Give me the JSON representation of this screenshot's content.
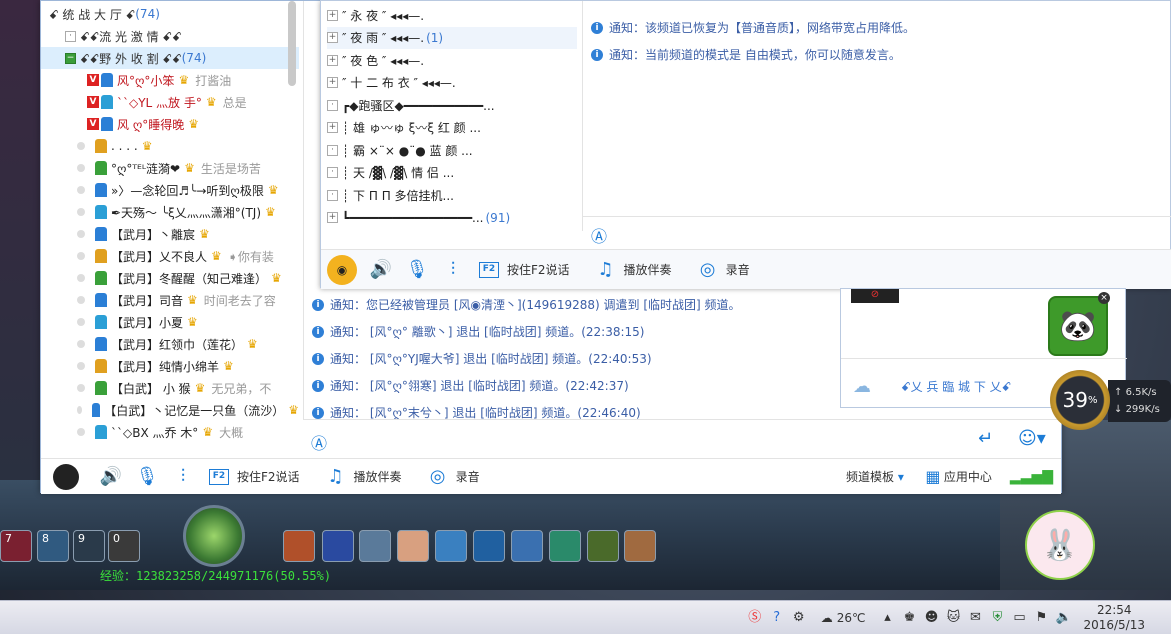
{
  "colors": {
    "accent": "#1d7cd6",
    "notice": "#3b5ea6",
    "exp_green": "#3be03b",
    "red_name": "#c0161e"
  },
  "tree": {
    "rows": [
      {
        "kind": "channel",
        "text": "ꗃ  统 战 大 厅  ꗃ",
        "count": "(74)"
      },
      {
        "kind": "sub",
        "text": "ꗃꗃ流 光 激 情 ꗃꗃ"
      },
      {
        "kind": "sub-open",
        "text": "ꗃꗃ野 外 收 割 ꗃꗃ",
        "count": "(74)"
      },
      {
        "kind": "user",
        "name": "风°ღ°小笨",
        "sig": "打酱油",
        "red": true,
        "rank": "V",
        "badge": "♛"
      },
      {
        "kind": "user",
        "name": "``◇YL    灬放 手°",
        "sig": "总是",
        "red": true,
        "rank": "V",
        "badge": "♛"
      },
      {
        "kind": "user",
        "name": "风 ღ°睡得晚",
        "sig": "",
        "red": true,
        "rank": "V",
        "badge": "♛"
      },
      {
        "kind": "user",
        "name": ". . . .",
        "sig": "",
        "red": false,
        "rank": "",
        "badge": "♛"
      },
      {
        "kind": "user",
        "name": "°ღ°ᵀᴱᴸ涟漪❤",
        "sig": "生活是场苦",
        "red": false,
        "rank": "",
        "badge": "♛"
      },
      {
        "kind": "user",
        "name": "»〉—念轮回♬╰→听到ღ极限",
        "sig": "",
        "red": false,
        "rank": "",
        "badge": "♛"
      },
      {
        "kind": "user",
        "name": "✒天殇〜 ╰ξ乂灬灬潇湘°(TJ)",
        "sig": "",
        "red": false,
        "rank": "",
        "badge": "♛"
      },
      {
        "kind": "user",
        "name": "【武月】丶離宸",
        "sig": "",
        "red": false,
        "rank": "",
        "badge": "♛"
      },
      {
        "kind": "user",
        "name": "【武月】乂不良人",
        "sig": "➧你有装",
        "red": false,
        "rank": "",
        "badge": "♛"
      },
      {
        "kind": "user",
        "name": "【武月】冬醒醒（知己难逢）",
        "sig": "",
        "red": false,
        "rank": "",
        "badge": "♛"
      },
      {
        "kind": "user",
        "name": "【武月】司音",
        "sig": "时间老去了容",
        "red": false,
        "rank": "",
        "badge": "♛"
      },
      {
        "kind": "user",
        "name": "【武月】小夏",
        "sig": "",
        "red": false,
        "rank": "",
        "badge": "♛"
      },
      {
        "kind": "user",
        "name": "【武月】红领巾（莲花）",
        "sig": "",
        "red": false,
        "rank": "",
        "badge": "♛"
      },
      {
        "kind": "user",
        "name": "【武月】纯情小绵羊",
        "sig": "",
        "red": false,
        "rank": "",
        "badge": "♛"
      },
      {
        "kind": "user",
        "name": "【白武】 小 猴",
        "sig": "无兄弟，不",
        "red": false,
        "rank": "",
        "badge": "♛"
      },
      {
        "kind": "user",
        "name": "【白武】丶记忆是一只鱼（流沙）",
        "sig": "",
        "red": false,
        "rank": "",
        "badge": "♛"
      },
      {
        "kind": "user",
        "name": "``◇BX    灬乔 木°",
        "sig": "大概",
        "red": false,
        "rank": "",
        "badge": "♛"
      }
    ]
  },
  "main_chat": {
    "messages": [
      "通知：您已经被管理员 [风◉清湮丶](149619288) 调遣到 [临时战团] 频道。",
      "通知： [风°ღ° 離歌丶] 退出 [临时战团] 频道。(22:38:15)",
      "通知： [风°ღ°YJ喔大爷] 退出 [临时战团] 频道。(22:40:53)",
      "通知： [风°ღ°翎寒] 退出 [临时战团] 频道。(22:42:37)",
      "通知： [风°ღ°末兮丶] 退出 [临时战团] 频道。(22:46:40)"
    ]
  },
  "toolbar": {
    "f2": "F2",
    "talk": "按住F2说话",
    "music": "播放伴奏",
    "record": "录音",
    "template": "频道模板",
    "app_center": "应用中心"
  },
  "popup": {
    "channels": [
      {
        "text": "″  永    夜  ″ ◂◂◂—.",
        "count": ""
      },
      {
        "text": "″  夜    雨  ″ ◂◂◂—.",
        "count": "(1)"
      },
      {
        "text": "″  夜    色  ″ ◂◂◂—.",
        "count": ""
      },
      {
        "text": "″ 十 二 布 衣 ″ ◂◂◂—.",
        "count": ""
      },
      {
        "text": "┏◆跑骚区◆━━━━━━━━━━━...",
        "count": ""
      },
      {
        "text": "┊ 雄  ゅ〰ゅ  ξ〰ξ  红  颜 ...",
        "count": ""
      },
      {
        "text": "┊ 霸  ×¨×  ●¨●  蓝  颜 ...",
        "count": ""
      },
      {
        "text": "┊ 天  /▓\\   /▓\\  情  侣 ...",
        "count": ""
      },
      {
        "text": "┊ 下   Π    Π   多倍挂机...",
        "count": ""
      },
      {
        "text": "┗━━━━━━━━━━━━━━━━━...",
        "count": "(91)"
      }
    ],
    "notices": [
      "通知：该频道已恢复为【普通音质】，网络带宽占用降低。",
      "通知：当前频道的模式是 自由模式，你可以随意发言。"
    ]
  },
  "mini_popup": {
    "text": "ꗃ乂 兵 臨 城 下 乂ꗃ"
  },
  "netspeed": {
    "percent": "39",
    "unit": "%",
    "up": "6.5K/s",
    "down": "299K/s"
  },
  "game": {
    "exp": "经验：123823258/244971176(50.55%)",
    "slots": [
      "7",
      "8",
      "9",
      "0"
    ]
  },
  "taskbar": {
    "temp": "26℃",
    "time": "22:54",
    "date": "2016/5/13"
  }
}
